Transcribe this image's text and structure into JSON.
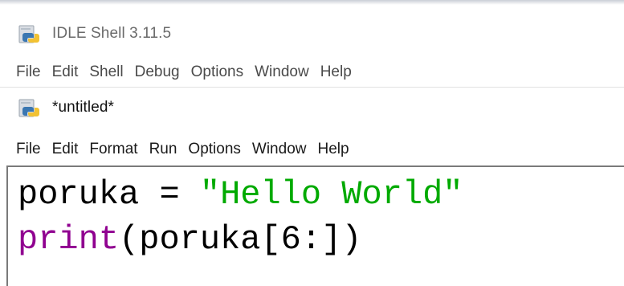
{
  "shell_window": {
    "title": "IDLE Shell 3.11.5",
    "icon": "python-idle-icon",
    "menu": [
      "File",
      "Edit",
      "Shell",
      "Debug",
      "Options",
      "Window",
      "Help"
    ]
  },
  "editor_window": {
    "title": "*untitled*",
    "icon": "python-idle-icon",
    "menu": [
      "File",
      "Edit",
      "Format",
      "Run",
      "Options",
      "Window",
      "Help"
    ],
    "code": {
      "line1": {
        "name": "poruka",
        "op": " = ",
        "string": "\"Hello World\""
      },
      "line2": {
        "builtin": "print",
        "rest": "(poruka[6:])"
      }
    }
  },
  "colors": {
    "string": "#00aa00",
    "builtin": "#900090",
    "default": "#000000"
  }
}
